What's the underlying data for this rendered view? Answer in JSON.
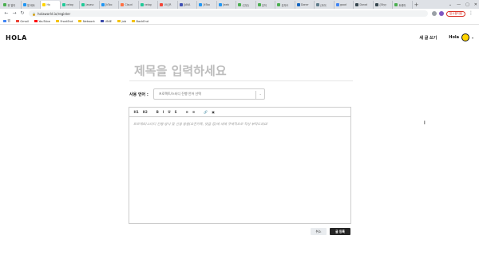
{
  "browser": {
    "tabs": [
      {
        "label": "위 알리",
        "color": "#4caf50"
      },
      {
        "label": "할 테트",
        "color": "#2196f3"
      },
      {
        "label": "Ho",
        "color": "#ffd400",
        "active": true
      },
      {
        "label": "velog",
        "color": "#20c997"
      },
      {
        "label": "Javasc",
        "color": "#20c997"
      },
      {
        "label": "[kToo",
        "color": "#2196f3"
      },
      {
        "label": "Cloud",
        "color": "#ff7043"
      },
      {
        "label": "velog",
        "color": "#20c997"
      },
      {
        "label": "UI) [R",
        "color": "#f44336"
      },
      {
        "label": "[JAVA",
        "color": "#3f51b5"
      },
      {
        "label": "[kToo",
        "color": "#2196f3"
      },
      {
        "label": "[web",
        "color": "#2196f3"
      },
      {
        "label": "(인년)",
        "color": "#4caf50"
      },
      {
        "label": "유저",
        "color": "#4caf50"
      },
      {
        "label": "유자도",
        "color": "#4caf50"
      },
      {
        "label": "Doner",
        "color": "#1565c0"
      },
      {
        "label": "[타이",
        "color": "#607d8b"
      },
      {
        "label": "good",
        "color": "#4285f4"
      },
      {
        "label": "Donat",
        "color": "#37474f"
      },
      {
        "label": "{Styy",
        "color": "#37474f"
      },
      {
        "label": "트렌마",
        "color": "#4caf50"
      }
    ],
    "new_tab": "+",
    "window_controls": [
      "⌄",
      "—",
      "▢",
      "✕"
    ],
    "url": "holaworld.io/register",
    "paused_label": "일시중지됨",
    "bookmarks": [
      {
        "label": "앱",
        "color": "#4285f4"
      },
      {
        "label": "Gmail",
        "color": "#ea4335"
      },
      {
        "label": "YouTube",
        "color": "#ff0000"
      },
      {
        "label": "FrontEnd",
        "color": "#f4c20d"
      },
      {
        "label": "Network",
        "color": "#f4c20d"
      },
      {
        "label": "UNIE",
        "color": "#3949ab"
      },
      {
        "label": "job",
        "color": "#f4c20d"
      },
      {
        "label": "BackEnd",
        "color": "#f4c20d"
      }
    ]
  },
  "header": {
    "logo": "HOLA",
    "new_post": "새 글 쓰기",
    "user_name": "Hola"
  },
  "form": {
    "title_placeholder": "제목을 입력하세요",
    "lang_label": "사용 언어 :",
    "lang_placeholder": "프로젝트/스터디 진행 언어 선택",
    "toolbar": [
      "H1",
      "H2",
      "B",
      "I",
      "U",
      "S",
      "≡",
      "≡",
      "🔗",
      "▣"
    ],
    "editor_placeholder": "프로젝트/스터디 진행 방식 및 신청 방법(오픈카톡, 댓글 등)에 대해 구체적으로 작성 부탁드려요!",
    "cancel": "취소",
    "submit": "글 등록"
  }
}
